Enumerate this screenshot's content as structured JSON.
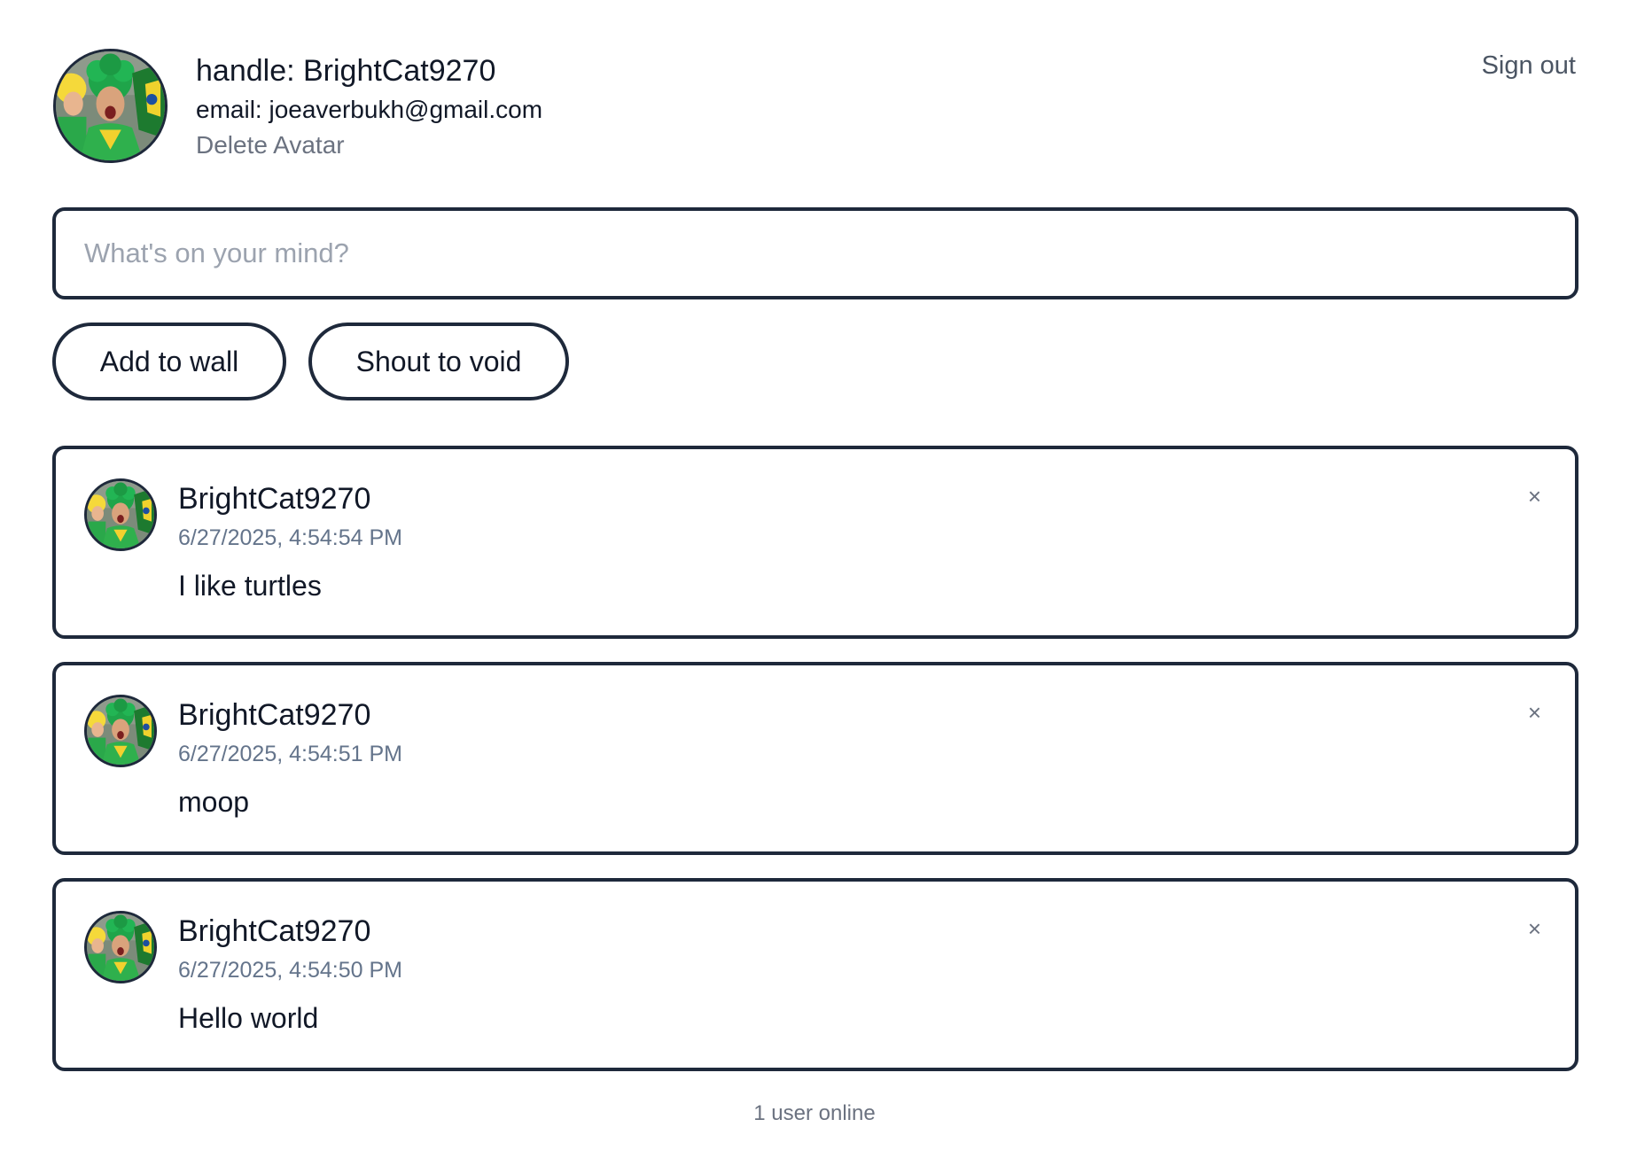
{
  "header": {
    "avatar_alt": "user avatar",
    "handle": "handle: BrightCat9270",
    "email": "email: joeaverbukh@gmail.com",
    "delete_avatar_label": "Delete Avatar",
    "sign_out_label": "Sign out"
  },
  "composer": {
    "placeholder": "What's on your mind?",
    "value": "",
    "add_to_wall_label": "Add to wall",
    "shout_to_void_label": "Shout to void"
  },
  "posts": [
    {
      "author": "BrightCat9270",
      "timestamp": "6/27/2025, 4:54:54 PM",
      "text": "I like turtles",
      "close_icon": "×"
    },
    {
      "author": "BrightCat9270",
      "timestamp": "6/27/2025, 4:54:51 PM",
      "text": "moop",
      "close_icon": "×"
    },
    {
      "author": "BrightCat9270",
      "timestamp": "6/27/2025, 4:54:50 PM",
      "text": "Hello world",
      "close_icon": "×"
    }
  ],
  "footer": {
    "online_status": "1 user online"
  },
  "colors": {
    "border": "#1e293b",
    "muted_text": "#6b7280",
    "timestamp_text": "#64748b",
    "placeholder_text": "#9ca3af"
  }
}
